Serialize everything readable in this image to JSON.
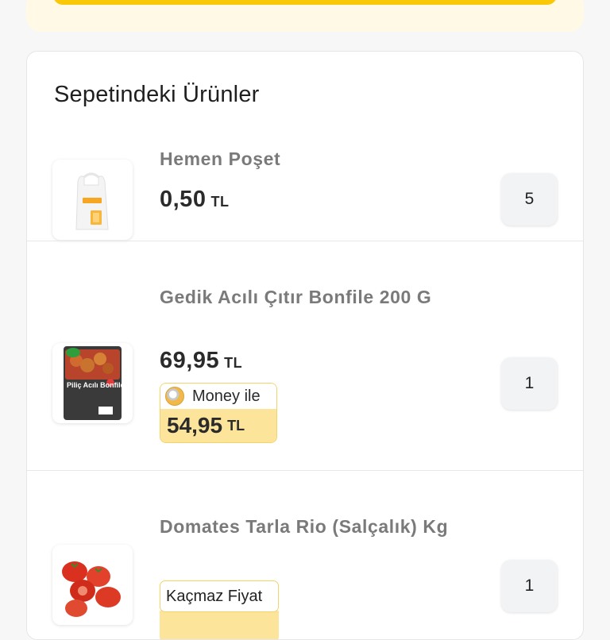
{
  "cart": {
    "title": "Sepetindeki Ürünler",
    "items": [
      {
        "name": "Hemen Poşet",
        "price": "0,50",
        "currency": "TL",
        "quantity": "5"
      },
      {
        "name": "Gedik Acılı Çıtır Bonfile 200 G",
        "price": "69,95",
        "currency": "TL",
        "quantity": "1",
        "money_label": "Money ile",
        "money_price": "54,95",
        "money_currency": "TL",
        "product_image_text": "Piliç Acılı Bonfile"
      },
      {
        "name": "Domates Tarla Rio (Salçalık) Kg",
        "badge": "Kaçmaz Fiyat",
        "quantity": "1"
      }
    ]
  },
  "colors": {
    "accent_yellow": "#f9c806",
    "money_bg": "#fce49a"
  }
}
